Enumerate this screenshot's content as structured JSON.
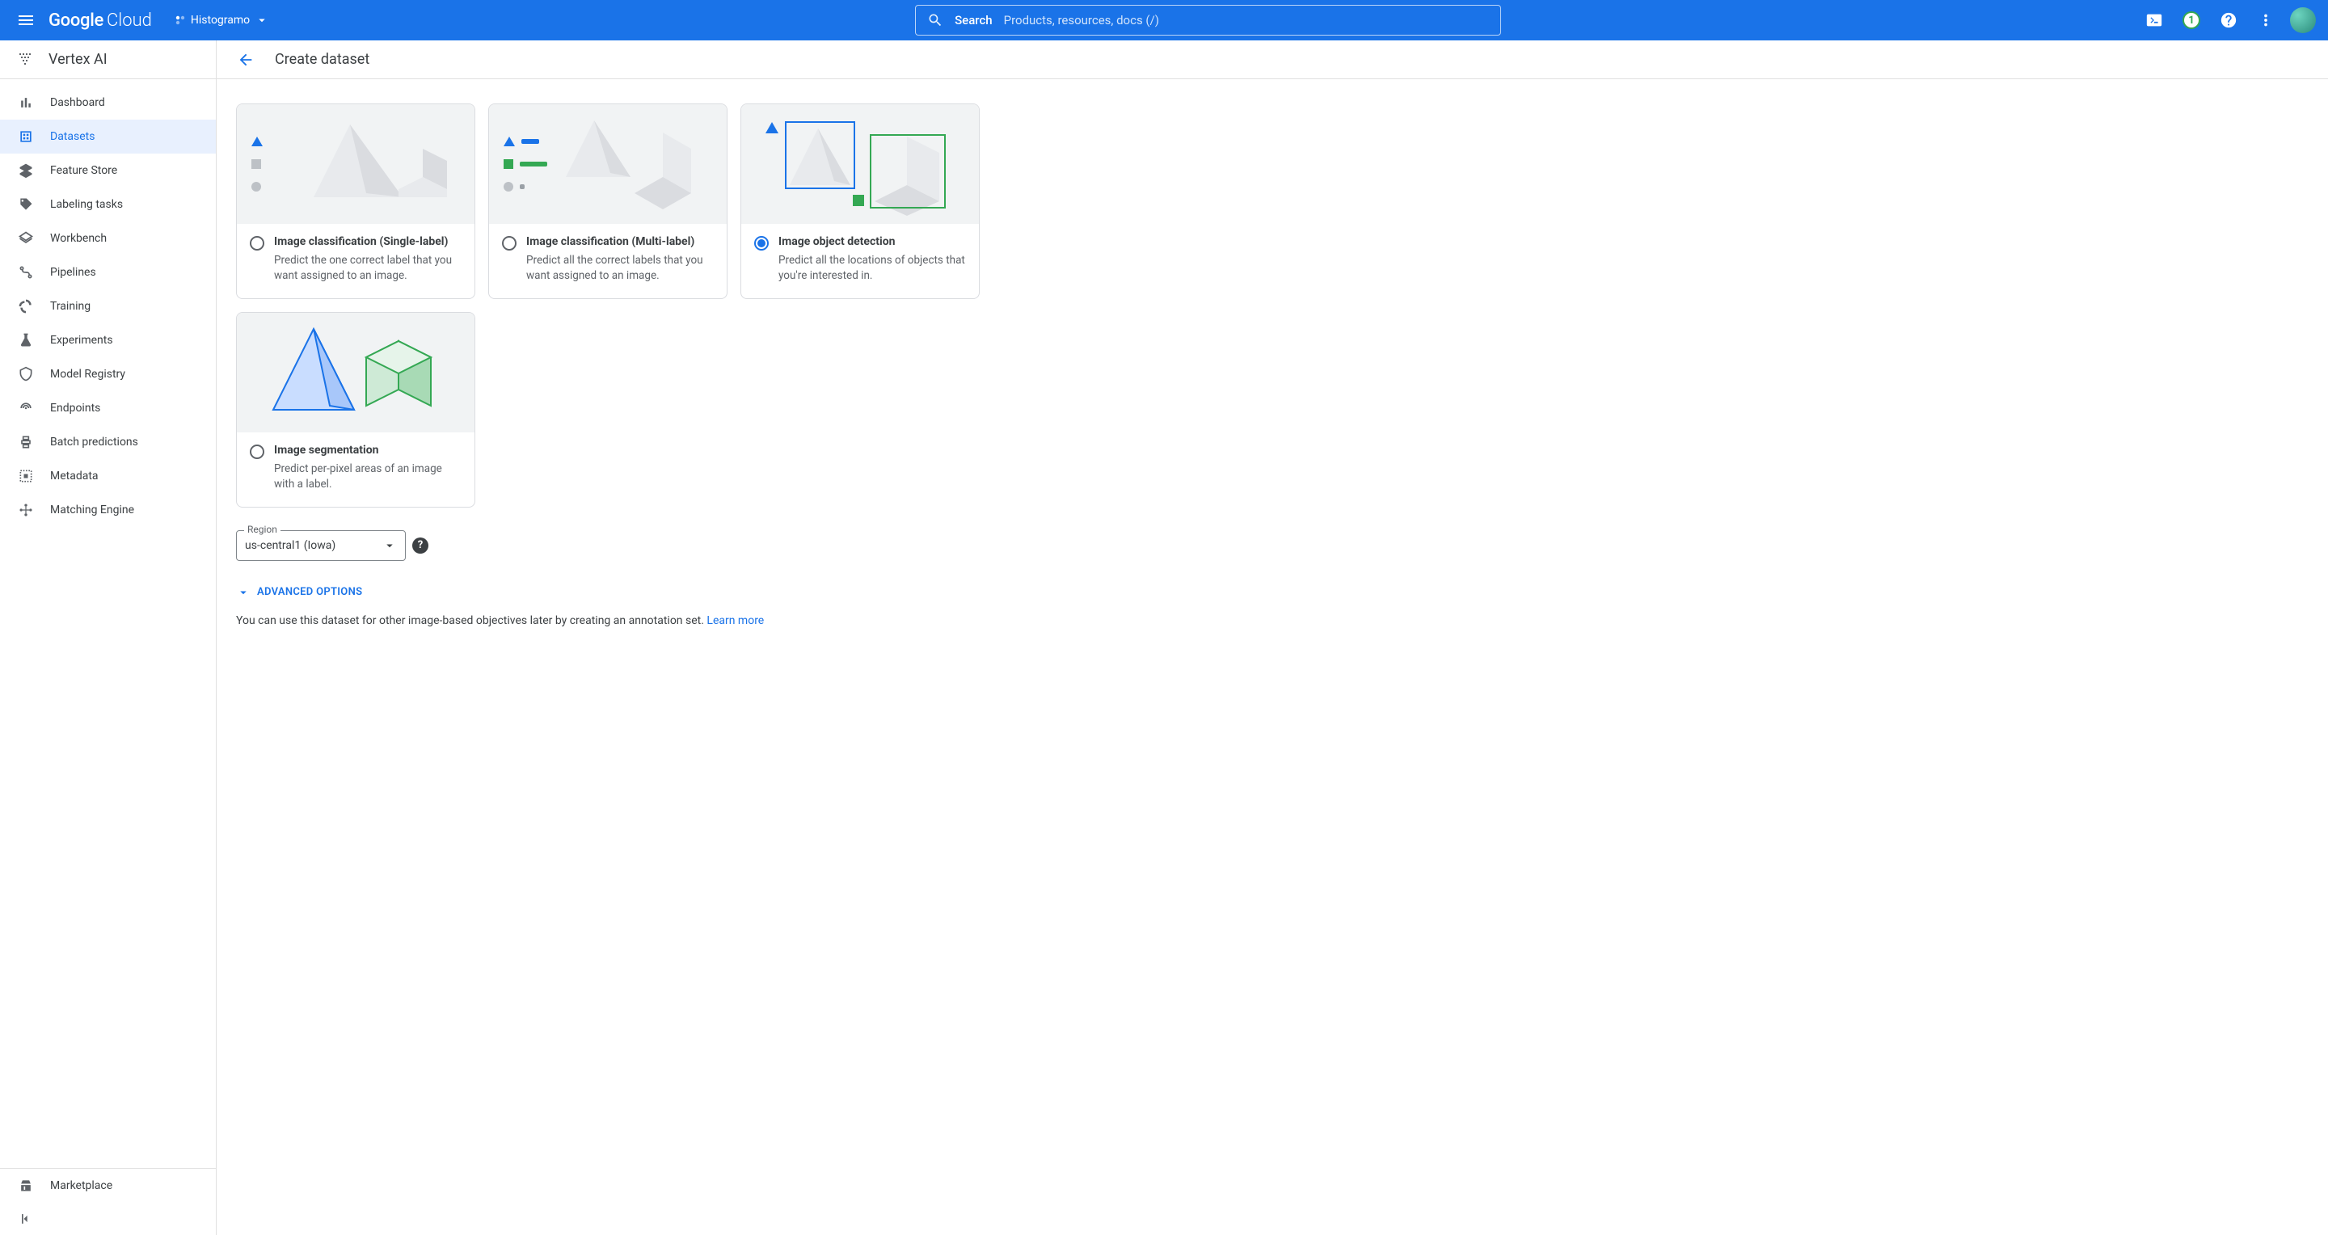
{
  "header": {
    "logo1": "Google",
    "logo2": "Cloud",
    "project": "Histogramo",
    "search_label": "Search",
    "search_placeholder": "Products, resources, docs (/)",
    "trial_badge": "1"
  },
  "sidebar": {
    "product": "Vertex AI",
    "items": [
      {
        "label": "Dashboard"
      },
      {
        "label": "Datasets"
      },
      {
        "label": "Feature Store"
      },
      {
        "label": "Labeling tasks"
      },
      {
        "label": "Workbench"
      },
      {
        "label": "Pipelines"
      },
      {
        "label": "Training"
      },
      {
        "label": "Experiments"
      },
      {
        "label": "Model Registry"
      },
      {
        "label": "Endpoints"
      },
      {
        "label": "Batch predictions"
      },
      {
        "label": "Metadata"
      },
      {
        "label": "Matching Engine"
      }
    ],
    "marketplace": "Marketplace"
  },
  "page": {
    "title": "Create dataset",
    "cards": [
      {
        "title": "Image classification (Single-label)",
        "desc": "Predict the one correct label that you want assigned to an image."
      },
      {
        "title": "Image classification (Multi-label)",
        "desc": "Predict all the correct labels that you want assigned to an image."
      },
      {
        "title": "Image object detection",
        "desc": "Predict all the locations of objects that you're interested in."
      },
      {
        "title": "Image segmentation",
        "desc": "Predict per-pixel areas of an image with a label."
      }
    ],
    "region_label": "Region",
    "region_value": "us-central1 (Iowa)",
    "advanced": "ADVANCED OPTIONS",
    "note": "You can use this dataset for other image-based objectives later by creating an annotation set. ",
    "learn_more": "Learn more"
  }
}
